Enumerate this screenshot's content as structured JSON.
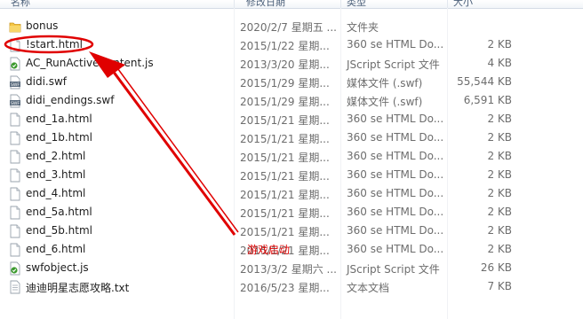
{
  "header": {
    "name_label": "名称",
    "date_label": "修改日期",
    "type_label": "类型",
    "size_label": "大小"
  },
  "files": [
    {
      "name": "bonus",
      "date": "2020/2/7 星期五 ...",
      "type": "文件夹",
      "size": "",
      "icon": "folder-icon"
    },
    {
      "name": "!start.html",
      "date": "2015/1/22 星期...",
      "type": "360 se HTML Do...",
      "size": "2 KB",
      "icon": "html-file-icon"
    },
    {
      "name": "AC_RunActiveContent.js",
      "date": "2013/3/20 星期...",
      "type": "JScript Script 文件",
      "size": "4 KB",
      "icon": "js-file-icon"
    },
    {
      "name": "didi.swf",
      "date": "2015/1/29 星期...",
      "type": "媒体文件 (.swf)",
      "size": "55,544 KB",
      "icon": "swf-file-icon"
    },
    {
      "name": "didi_endings.swf",
      "date": "2015/1/29 星期...",
      "type": "媒体文件 (.swf)",
      "size": "6,591 KB",
      "icon": "swf-file-icon"
    },
    {
      "name": "end_1a.html",
      "date": "2015/1/21 星期...",
      "type": "360 se HTML Do...",
      "size": "2 KB",
      "icon": "html-file-icon"
    },
    {
      "name": "end_1b.html",
      "date": "2015/1/21 星期...",
      "type": "360 se HTML Do...",
      "size": "2 KB",
      "icon": "html-file-icon"
    },
    {
      "name": "end_2.html",
      "date": "2015/1/21 星期...",
      "type": "360 se HTML Do...",
      "size": "2 KB",
      "icon": "html-file-icon"
    },
    {
      "name": "end_3.html",
      "date": "2015/1/21 星期...",
      "type": "360 se HTML Do...",
      "size": "2 KB",
      "icon": "html-file-icon"
    },
    {
      "name": "end_4.html",
      "date": "2015/1/21 星期...",
      "type": "360 se HTML Do...",
      "size": "2 KB",
      "icon": "html-file-icon"
    },
    {
      "name": "end_5a.html",
      "date": "2015/1/21 星期...",
      "type": "360 se HTML Do...",
      "size": "2 KB",
      "icon": "html-file-icon"
    },
    {
      "name": "end_5b.html",
      "date": "2015/1/21 星期...",
      "type": "360 se HTML Do...",
      "size": "2 KB",
      "icon": "html-file-icon"
    },
    {
      "name": "end_6.html",
      "date": "2015/1/21 星期...",
      "type": "360 se HTML Do...",
      "size": "2 KB",
      "icon": "html-file-icon"
    },
    {
      "name": "swfobject.js",
      "date": "2013/3/2 星期六 ...",
      "type": "JScript Script 文件",
      "size": "26 KB",
      "icon": "js-file-icon"
    },
    {
      "name": "迪迪明星志愿攻略.txt",
      "date": "2016/5/23 星期...",
      "type": "文本文档",
      "size": "7 KB",
      "icon": "txt-file-icon"
    }
  ],
  "annotation": {
    "text": "游戏启动",
    "color": "#e00000"
  }
}
